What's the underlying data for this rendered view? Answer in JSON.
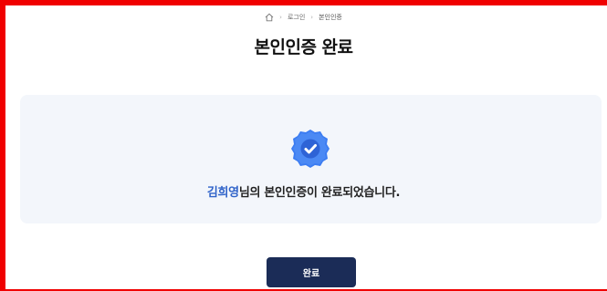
{
  "breadcrumb": {
    "home_icon": "home-icon",
    "separator": "›",
    "items": [
      {
        "label": "로그인"
      },
      {
        "label": "본인인증"
      }
    ]
  },
  "page_title": "본인인증 완료",
  "result": {
    "badge_icon": "verified-badge-icon",
    "user_name": "김희영",
    "message": "님의 본인인증이 완료되었습니다."
  },
  "done_button_label": "완료",
  "colors": {
    "frame_border": "#f00000",
    "panel_background": "#f3f6fb",
    "name_highlight": "#2f63c9",
    "badge_blue": "#3b7cf2",
    "button_background": "#1b2c57"
  }
}
